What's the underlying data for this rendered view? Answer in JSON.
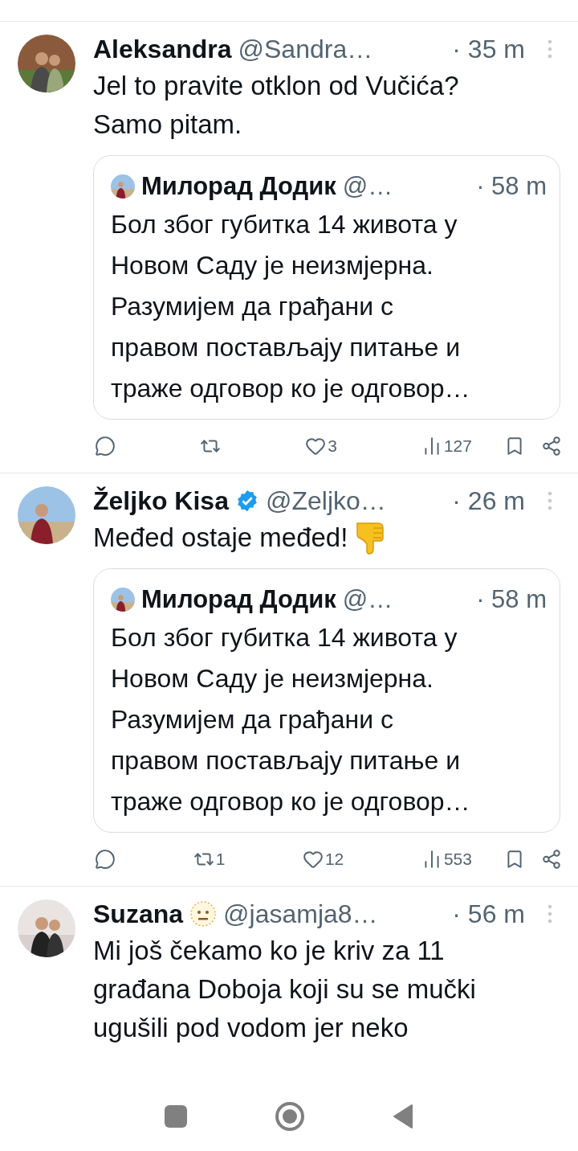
{
  "tweets": [
    {
      "name": "Aleksandra",
      "handle": "@Sandra…",
      "time": "· 35 m",
      "verified": false,
      "emoji_badge": false,
      "emoji_reaction": false,
      "text": "Jel to pravite otklon od Vučića?\nSamo pitam.",
      "quote": {
        "name": "Милорад Додик",
        "handle": "@…",
        "time": "· 58 m",
        "text": "Бол због губитка 14 живота у\nНовом Саду је неизмјерна.\nРазумијем да грађани с\nправом постављају питање и\nтраже одговор ко је одговор…"
      },
      "stats": {
        "likes": "3",
        "views": "127"
      }
    },
    {
      "name": "Željko Kisa",
      "handle": "@Zeljko…",
      "time": "· 26 m",
      "verified": true,
      "emoji_badge": false,
      "emoji_reaction": true,
      "text": "Međed ostaje međed!",
      "quote": {
        "name": "Милорад Додик",
        "handle": "@…",
        "time": "· 58 m",
        "text": "Бол због губитка 14 живота у\nНовом Саду је неизмјерна.\nРазумијем да грађани с\nправом постављају питање и\nтраже одговор ко је одговор…"
      },
      "stats": {
        "retweets": "1",
        "likes": "12",
        "views": "553"
      }
    },
    {
      "name": "Suzana",
      "handle": "@jasamja8…",
      "time": "· 56 m",
      "verified": false,
      "emoji_badge": true,
      "emoji_reaction": false,
      "text": "Mi još čekamo ko je kriv za 11\ngrađana Doboja koji su se mučki\nugušili pod vodom jer neko"
    }
  ]
}
